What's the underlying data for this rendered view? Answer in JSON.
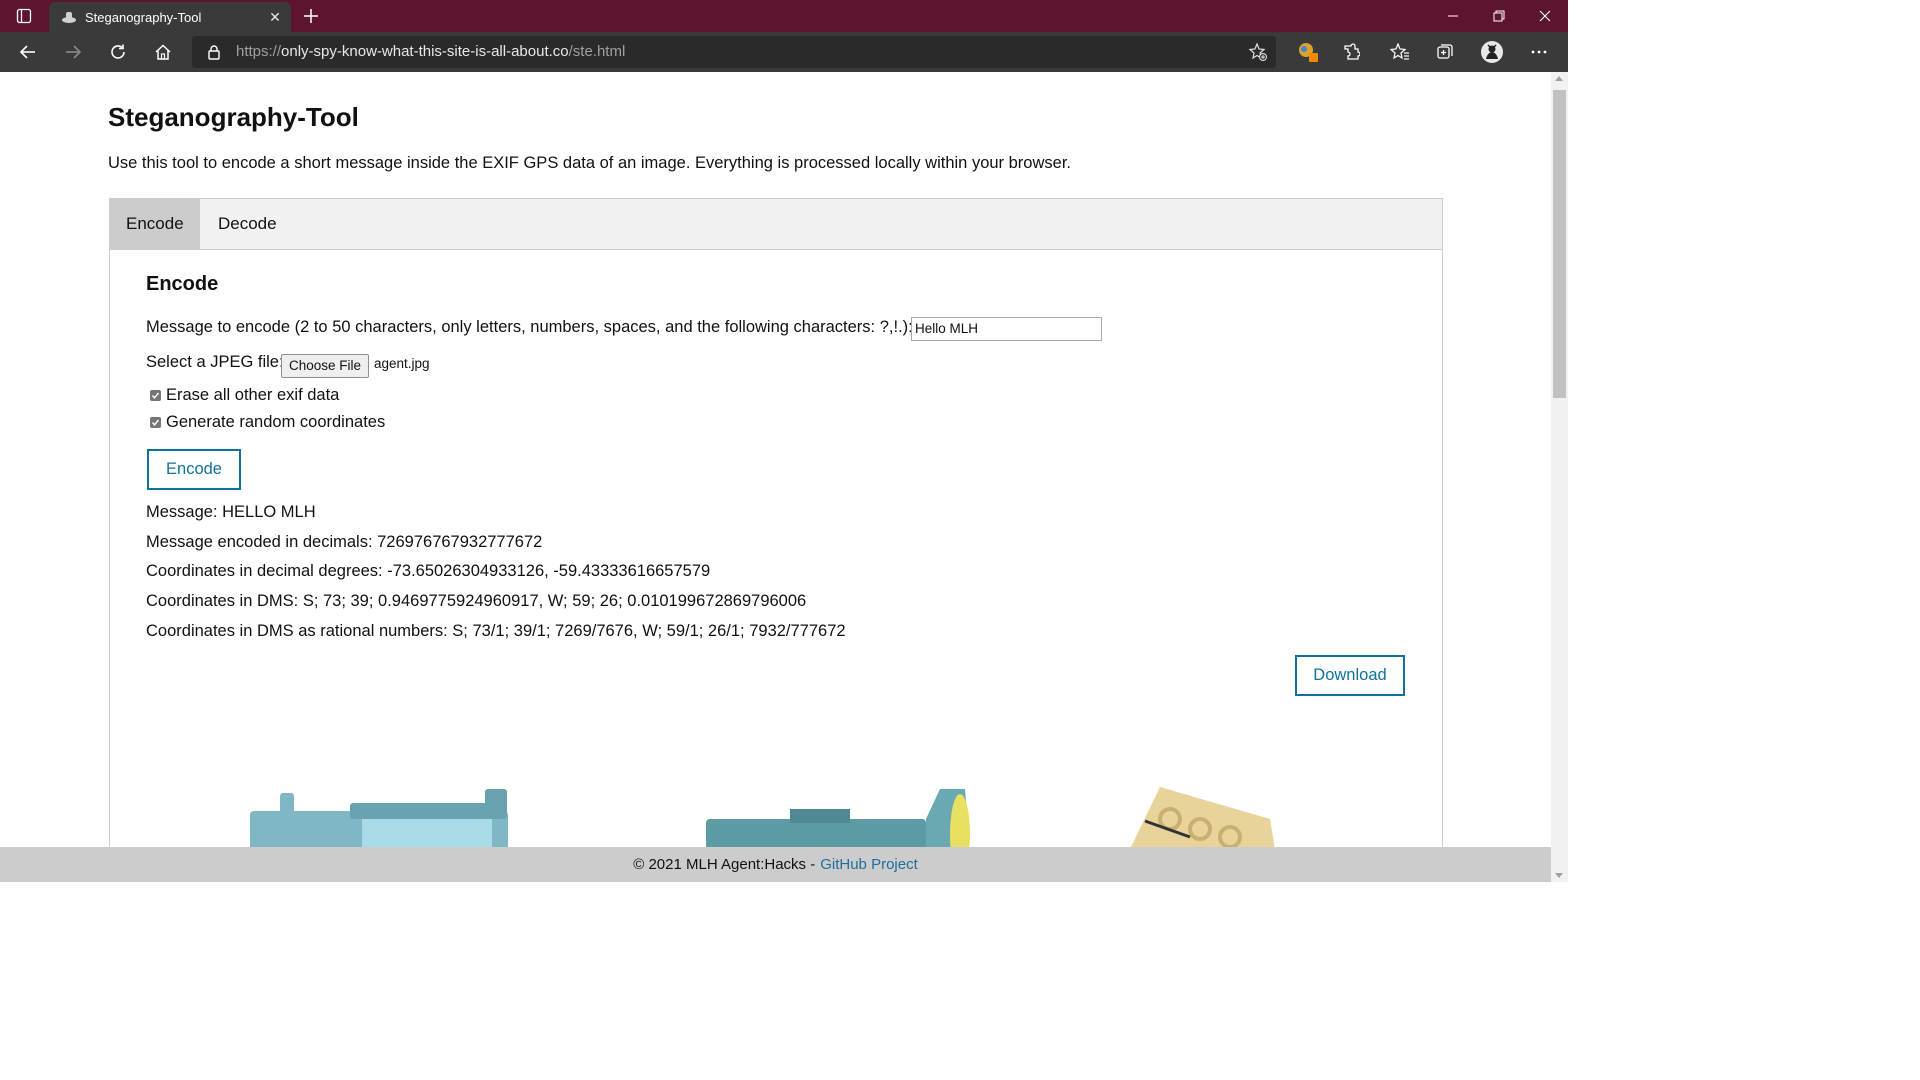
{
  "browser": {
    "tab_title": "Steganography-Tool",
    "url_prefix": "https://",
    "url_host": "only-spy-know-what-this-site-is-all-about.co",
    "url_path": "/ste.html",
    "colors": {
      "tabbar": "#5e1430",
      "toolbar": "#3a3a3a"
    }
  },
  "page": {
    "title": "Steganography-Tool",
    "description": "Use this tool to encode a short message inside the EXIF GPS data of an image. Everything is processed locally within your browser.",
    "tabs": [
      {
        "label": "Encode",
        "active": true
      },
      {
        "label": "Decode",
        "active": false
      }
    ],
    "encode": {
      "heading": "Encode",
      "message_label": "Message to encode (2 to 50 characters, only letters, numbers, spaces, and the following characters: ?,!.):",
      "message_value": "Hello MLH",
      "file_label": "Select a JPEG file:",
      "file_button": "Choose File",
      "file_name": "agent.jpg",
      "erase_exif_label": "Erase all other exif data",
      "erase_exif_checked": true,
      "random_coords_label": "Generate random coordinates",
      "random_coords_checked": true,
      "encode_button": "Encode",
      "results": [
        "Message: HELLO MLH",
        "Message encoded in decimals: 726976767932777672",
        "Coordinates in decimal degrees: -73.65026304933126, -59.43333616657579",
        "Coordinates in DMS: S; 73; 39; 0.9469775924960917, W; 59; 26; 0.010199672869796006",
        "Coordinates in DMS as rational numbers: S; 73/1; 39/1; 7269/7676, W; 59/1; 26/1; 7932/777672"
      ],
      "download_button": "Download"
    },
    "footer": {
      "text": "© 2021 MLH Agent:Hacks -",
      "link": "GitHub Project"
    },
    "accent_color": "#0f7399"
  }
}
